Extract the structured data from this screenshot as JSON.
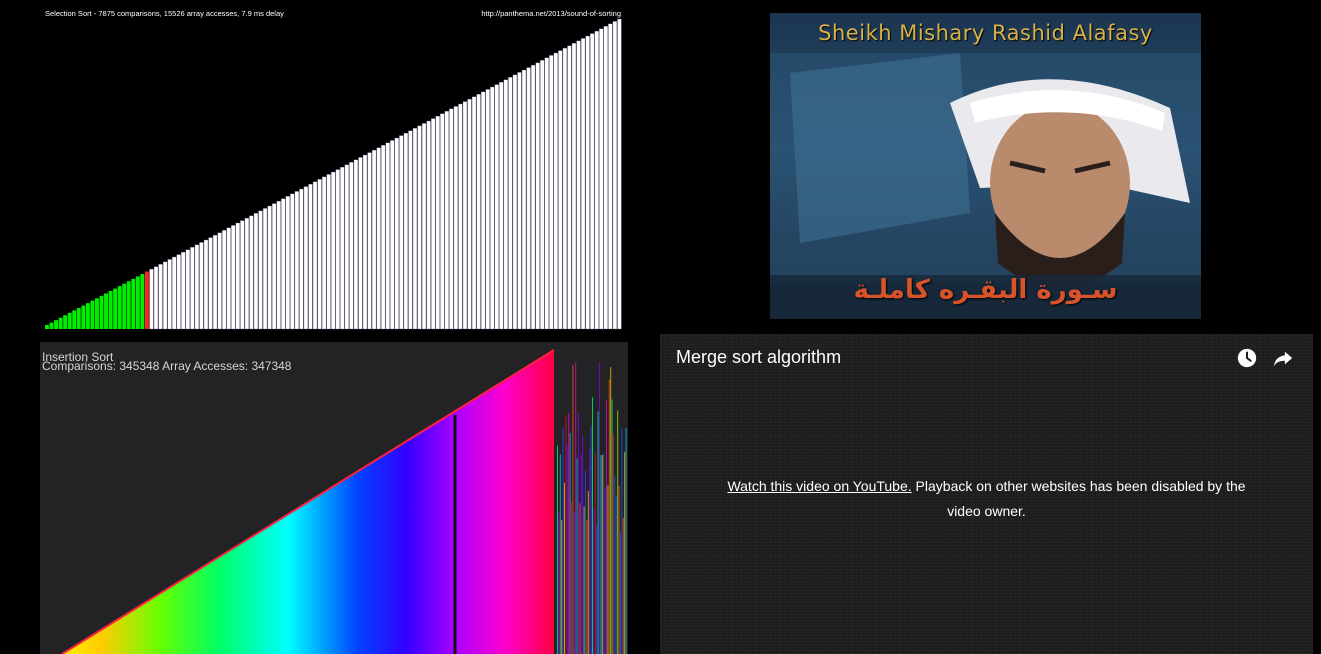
{
  "selection_sort": {
    "caption": "Selection Sort - 7875 comparisons, 15526 array accesses, 7.9 ms delay",
    "url": "http://panthema.net/2013/sound-of-sorting",
    "colors": {
      "sorted": "#00ee00",
      "current": "#ff2222",
      "unsorted": "#ffffff",
      "edge": "#6a5a88"
    }
  },
  "thumbnail": {
    "title": "Sheikh Mishary Rashid Alafasy",
    "arabic_text": "سـورة البقـره كاملـة"
  },
  "insertion_sort": {
    "title": "Insertion Sort",
    "stats": "Comparisons: 345348 Array Accesses: 347348"
  },
  "video": {
    "title": "Merge sort algorithm",
    "link_text": "Watch this video on YouTube.",
    "message": " Playback on other websites has been disabled by the video owner.",
    "icons": [
      "watch-later-icon",
      "share-icon"
    ]
  }
}
